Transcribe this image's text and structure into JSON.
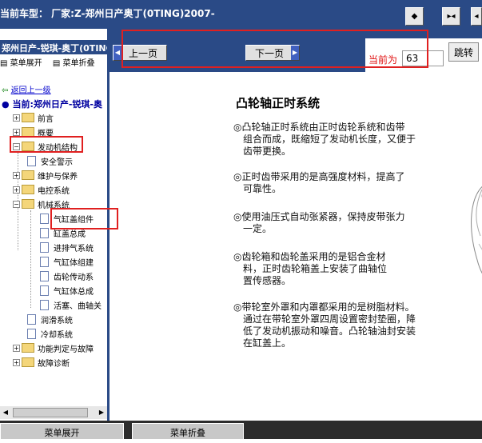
{
  "top": {
    "car_label": "当前车型：  厂家:Z-郑州日产奥丁(0TING)2007-"
  },
  "left": {
    "title": "郑州日产-锐琪-奥丁(0TING",
    "expand_all": "菜单展开",
    "collapse_all": "菜单折叠",
    "back": "返回上一级",
    "current": "当前:郑州日产-锐琪-奥",
    "tree": [
      {
        "label": "前言"
      },
      {
        "label": "概要"
      },
      {
        "label": "发动机结构"
      },
      {
        "label": "安全警示"
      },
      {
        "label": "维护与保养"
      },
      {
        "label": "电控系统"
      },
      {
        "label": "机械系统"
      },
      {
        "label": "气缸盖组件"
      },
      {
        "label": "缸盖总成"
      },
      {
        "label": "进排气系统"
      },
      {
        "label": "气缸体组建"
      },
      {
        "label": "齿轮传动系"
      },
      {
        "label": "气缸体总成"
      },
      {
        "label": "活塞、曲轴关"
      },
      {
        "label": "润滑系统"
      },
      {
        "label": "冷却系统"
      },
      {
        "label": "功能判定与故障"
      },
      {
        "label": "故障诊断"
      }
    ]
  },
  "nav": {
    "prev": "上一页",
    "next": "下一页",
    "page_label": "当前为",
    "page_value": "63",
    "jump": "跳转"
  },
  "content": {
    "title": "凸轮轴正时系统",
    "paragraphs": [
      {
        "first": "◎凸轮轴正时系统由正时齿轮系统和齿带",
        "rest": [
          "组合而成，既缩短了发动机长度，又便于",
          "齿带更换。"
        ]
      },
      {
        "first": "◎正时齿带采用的是高强度材料，提高了",
        "rest": [
          "可靠性。"
        ]
      },
      {
        "first": "◎使用油压式自动张紧器，保持皮带张力",
        "rest": [
          "一定。"
        ]
      },
      {
        "first": "◎齿轮箱和齿轮盖采用的是铝合金材",
        "rest": [
          "料，正时齿轮箱盖上安装了曲轴位",
          "置传感器。"
        ]
      },
      {
        "first": "◎带轮室外罩和内罩都采用的是树脂材料。",
        "rest": [
          "通过在带轮室外罩四周设置密封垫圈，降",
          "低了发动机振动和噪音。凸轮轴油封安装",
          "在缸盖上。"
        ]
      }
    ]
  },
  "bottom": {
    "expand": "菜单展开",
    "collapse": "菜单折叠"
  }
}
